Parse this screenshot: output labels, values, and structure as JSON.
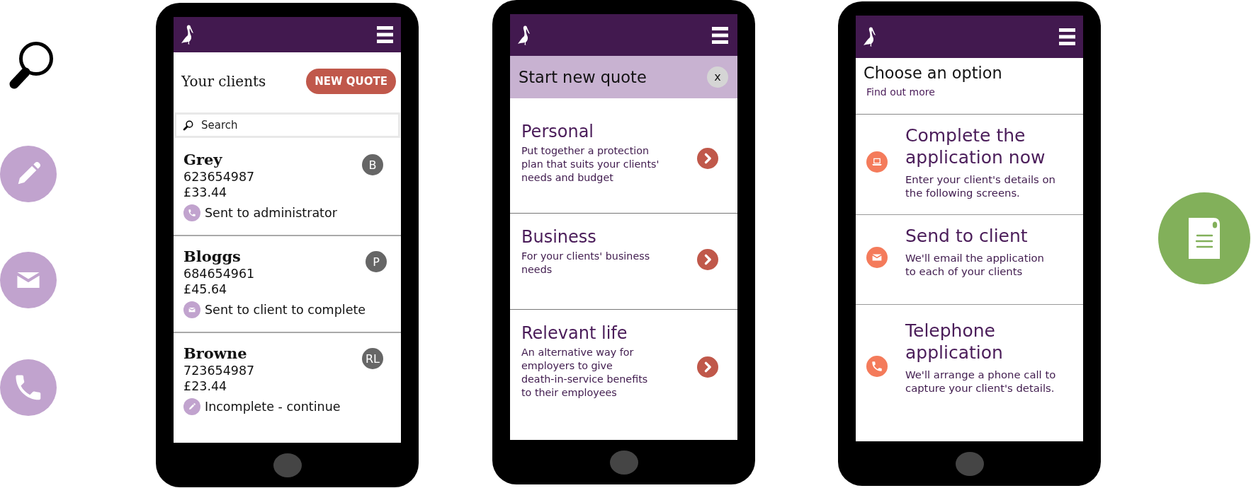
{
  "phones": [
    {
      "kind": "clients",
      "title": "Your clients",
      "new_quote_button": "NEW QUOTE",
      "search": {
        "placeholder": "Search"
      },
      "clients": [
        {
          "name": "Grey",
          "number": "623654987",
          "amount": "£33.44",
          "badge": "B",
          "status": {
            "kind": "call",
            "text": "Sent to administrator"
          }
        },
        {
          "name": "Bloggs",
          "number": "684654961",
          "amount": "£45.64",
          "badge": "P",
          "status": {
            "kind": "email",
            "text": "Sent to client to complete"
          }
        },
        {
          "name": "Browne",
          "number": "723654987",
          "amount": "£23.44",
          "badge": "RL",
          "status": {
            "kind": "edit",
            "text": "Incomplete - continue"
          }
        }
      ]
    },
    {
      "kind": "quote",
      "title": "Start new quote",
      "close_button": "x",
      "options": [
        {
          "title": "Personal",
          "description": "Put together a protection\nplan that suits your clients'\nneeds and budget"
        },
        {
          "title": "Business",
          "description": "For your clients' business\nneeds"
        },
        {
          "title": "Relevant life",
          "description": "An alternative way for\nemployers to give\ndeath-in-service benefits\nto their employees"
        }
      ]
    },
    {
      "kind": "options",
      "title": "Choose an option",
      "link": "Find out more",
      "options": [
        {
          "kind": "online",
          "title": "Complete the application now",
          "description": "Enter your client's details on\nthe following screens."
        },
        {
          "kind": "email",
          "title": "Send to client",
          "description": "We'll email the application\nto each of your clients"
        },
        {
          "kind": "call",
          "title": "Telephone application",
          "description": "We'll arrange a phone call to\ncapture your client's details."
        }
      ]
    }
  ]
}
